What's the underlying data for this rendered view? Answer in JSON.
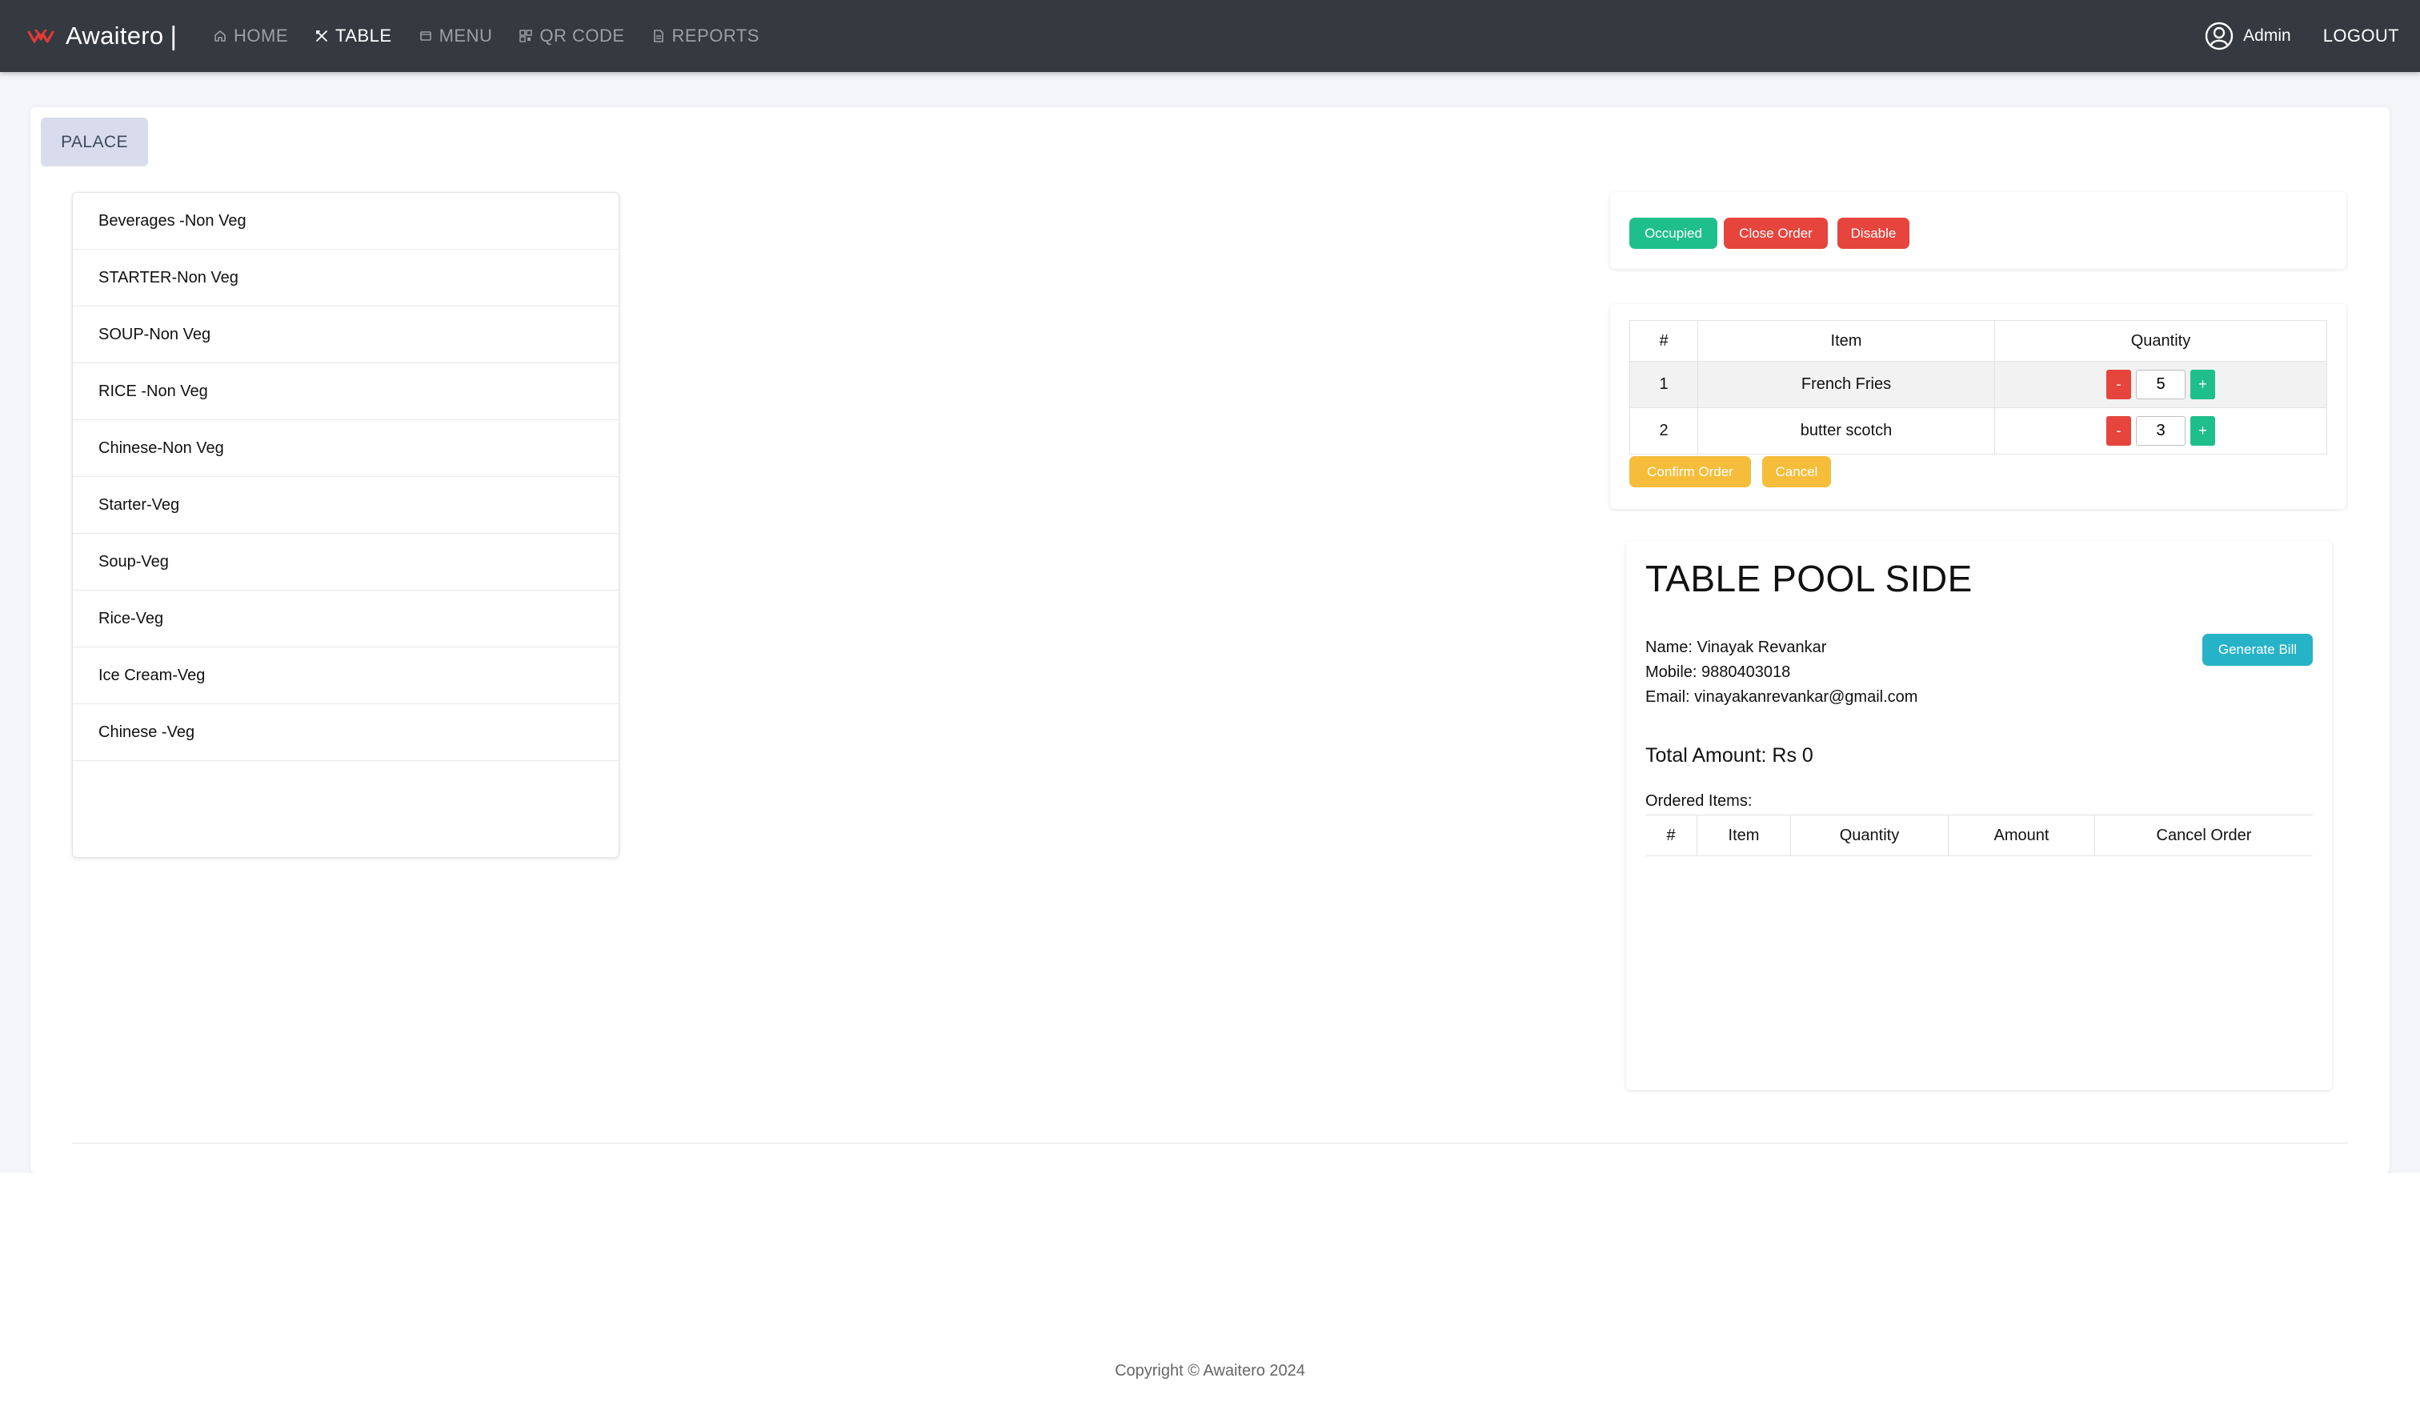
{
  "app": {
    "name": "Awaitero",
    "separator": "|"
  },
  "nav": {
    "items": [
      {
        "label": "HOME",
        "icon": "home-icon"
      },
      {
        "label": "TABLE",
        "icon": "utensils-icon"
      },
      {
        "label": "MENU",
        "icon": "menu-icon"
      },
      {
        "label": "QR CODE",
        "icon": "qrcode-icon"
      },
      {
        "label": "REPORTS",
        "icon": "report-icon"
      }
    ],
    "active": "TABLE"
  },
  "user": {
    "name": "Admin",
    "logout": "LOGOUT"
  },
  "area_tab": "PALACE",
  "categories": [
    "Beverages -Non Veg",
    "STARTER-Non Veg",
    "SOUP-Non Veg",
    "RICE -Non Veg",
    "Chinese-Non Veg",
    "Starter-Veg",
    "Soup-Veg",
    "Rice-Veg",
    "Ice Cream-Veg",
    "Chinese -Veg"
  ],
  "status_buttons": {
    "occupied": "Occupied",
    "close_order": "Close Order",
    "disable": "Disable"
  },
  "order_table": {
    "headers": [
      "#",
      "Item",
      "Quantity"
    ],
    "rows": [
      {
        "num": "1",
        "item": "French Fries",
        "qty": "5"
      },
      {
        "num": "2",
        "item": "butter scotch",
        "qty": "3"
      }
    ],
    "minus": "-",
    "plus": "+",
    "confirm": "Confirm Order",
    "cancel": "Cancel"
  },
  "bill": {
    "title": "TABLE POOL SIDE",
    "name": "Name: Vinayak Revankar",
    "mobile": "Mobile: 9880403018",
    "email": "Email: vinayakanrevankar@gmail.com",
    "generate_bill": "Generate Bill",
    "total": "Total Amount: Rs 0",
    "ordered_label": "Ordered Items:",
    "headers": [
      "#",
      "Item",
      "Quantity",
      "Amount",
      "Cancel Order"
    ]
  },
  "footer": {
    "copyright": "Copyright © Awaitero 2024"
  },
  "colors": {
    "navbar": "#343a40",
    "green": "#1fbf8c",
    "red": "#e5453d",
    "yellow": "#f5bd3a",
    "teal": "#26b3c8",
    "brand_logo": "#e53935"
  }
}
